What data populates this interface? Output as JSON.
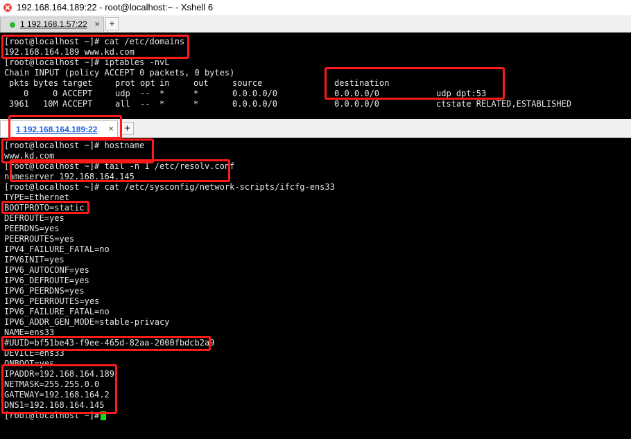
{
  "window": {
    "title": "192.168.164.189:22 - root@localhost:~ - Xshell 6"
  },
  "top_tab": {
    "number": "1",
    "label": "192.168.1.57:22",
    "close": "×",
    "plus": "+",
    "status_color": "#2fb82f"
  },
  "top_session": {
    "lines": [
      "[root@localhost ~]# cat /etc/domains",
      "192.168.164.189 www.kd.com",
      "[root@localhost ~]# iptables -nvL",
      "Chain INPUT (policy ACCEPT 0 packets, 0 bytes)"
    ],
    "table_header": [
      "pkts",
      "bytes",
      "target",
      "prot",
      "opt",
      "in",
      "out",
      "source",
      "destination",
      ""
    ],
    "table_rows": [
      [
        "0",
        "0",
        "ACCEPT",
        "udp",
        "--",
        "*",
        "*",
        "0.0.0.0/0",
        "0.0.0.0/0",
        "udp dpt:53"
      ],
      [
        "3961",
        "10M",
        "ACCEPT",
        "all",
        "--",
        "*",
        "*",
        "0.0.0.0/0",
        "0.0.0.0/0",
        "ctstate RELATED,ESTABLISHED"
      ]
    ]
  },
  "bottom_tab": {
    "number": "1",
    "label": "192.168.164.189:22",
    "close": "×",
    "plus": "+"
  },
  "bottom_session": {
    "lines": [
      "[root@localhost ~]# hostname",
      "www.kd.com",
      "[root@localhost ~]# tail -n 1 /etc/resolv.conf",
      "nameserver 192.168.164.145",
      "[root@localhost ~]# cat /etc/sysconfig/network-scripts/ifcfg-ens33",
      "TYPE=Ethernet",
      "BOOTPROTO=static",
      "DEFROUTE=yes",
      "PEERDNS=yes",
      "PEERROUTES=yes",
      "IPV4_FAILURE_FATAL=no",
      "IPV6INIT=yes",
      "IPV6_AUTOCONF=yes",
      "IPV6_DEFROUTE=yes",
      "IPV6_PEERDNS=yes",
      "IPV6_PEERROUTES=yes",
      "IPV6_FAILURE_FATAL=no",
      "IPV6_ADDR_GEN_MODE=stable-privacy",
      "NAME=ens33",
      "#UUID=bf51be43-f9ee-465d-82aa-2000fbdcb2a9",
      "DEVICE=ens33",
      "ONBOOT=yes",
      "IPADDR=192.168.164.189",
      "NETMASK=255.255.0.0",
      "GATEWAY=192.168.164.2",
      "DNS1=192.168.164.145",
      "[root@localhost ~]# "
    ]
  },
  "colors": {
    "highlight": "#ff1a1a",
    "cursor": "#1bd61b",
    "terminal_bg": "#000000",
    "terminal_fg": "#e6e6e6",
    "active_tab_text": "#1d5fd6"
  }
}
